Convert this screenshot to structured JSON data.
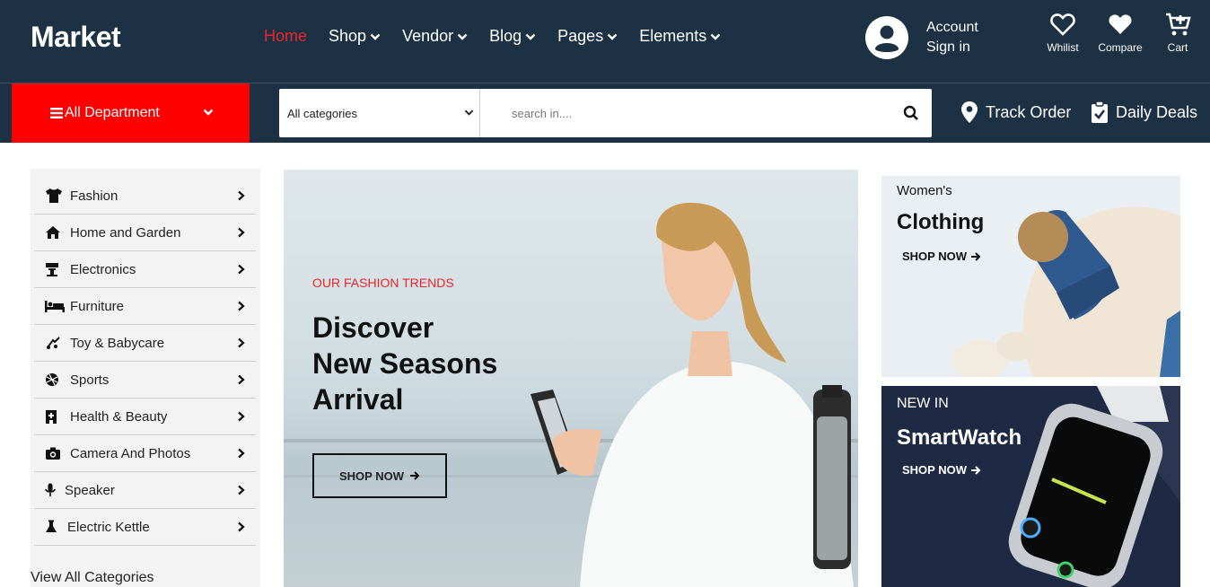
{
  "header": {
    "logo": "Market",
    "nav": [
      {
        "label": "Home",
        "active": true,
        "dropdown": false
      },
      {
        "label": "Shop",
        "active": false,
        "dropdown": true
      },
      {
        "label": "Vendor",
        "active": false,
        "dropdown": true
      },
      {
        "label": "Blog",
        "active": false,
        "dropdown": true
      },
      {
        "label": "Pages",
        "active": false,
        "dropdown": true
      },
      {
        "label": "Elements",
        "active": false,
        "dropdown": true
      }
    ],
    "account": {
      "line1": "Account",
      "line2": "Sign in"
    },
    "icons": [
      {
        "icon": "heart-outline-icon",
        "label": "Whilist"
      },
      {
        "icon": "heart-filled-icon",
        "label": "Compare"
      },
      {
        "icon": "cart-icon",
        "label": "Cart"
      }
    ]
  },
  "searchbar": {
    "department_label": "All Department",
    "category_selected": "All categories",
    "search_placeholder": "search in....",
    "track_order": "Track Order",
    "daily_deals": "Daily Deals"
  },
  "sidebar": {
    "items": [
      {
        "label": "Fashion",
        "icon": "tshirt-icon"
      },
      {
        "label": "Home and Garden",
        "icon": "home-icon"
      },
      {
        "label": "Electronics",
        "icon": "electronics-icon"
      },
      {
        "label": "Furniture",
        "icon": "bed-icon"
      },
      {
        "label": "Toy & Babycare",
        "icon": "toy-icon"
      },
      {
        "label": "Sports",
        "icon": "ball-icon"
      },
      {
        "label": "Health & Beauty",
        "icon": "health-icon"
      },
      {
        "label": "Camera And Photos",
        "icon": "camera-icon"
      },
      {
        "label": "Speaker",
        "icon": "microphone-icon"
      },
      {
        "label": "Electric Kettle",
        "icon": "kettle-icon"
      }
    ],
    "view_all": "View All Categories"
  },
  "hero": {
    "subtitle": "OUR FASHION TRENDS",
    "title_lines": [
      "Discover",
      "New Seasons",
      "Arrival"
    ],
    "button": "SHOP NOW"
  },
  "banners": [
    {
      "small": "Women's",
      "big": "Clothing",
      "button": "SHOP NOW"
    },
    {
      "small": "NEW IN",
      "big": "SmartWatch",
      "button": "SHOP NOW"
    }
  ],
  "colors": {
    "header_bg": "#1c3143",
    "accent_red": "#ff0000",
    "active_nav": "#e8262c"
  }
}
